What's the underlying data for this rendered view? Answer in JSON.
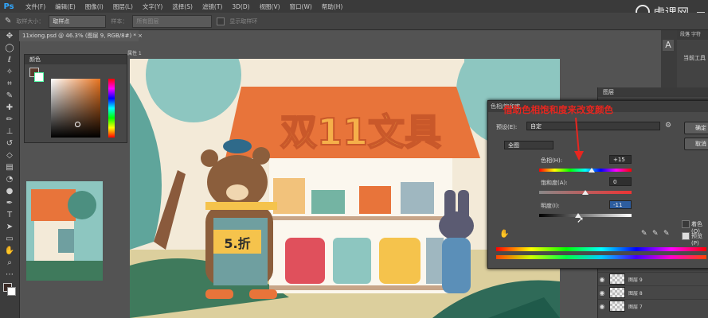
{
  "menu": {
    "logo": "Ps",
    "items": [
      "文件(F)",
      "编辑(E)",
      "图像(I)",
      "图层(L)",
      "文字(Y)",
      "选择(S)",
      "滤镜(T)",
      "3D(D)",
      "视图(V)",
      "窗口(W)",
      "帮助(H)"
    ]
  },
  "watermark": {
    "text": "虎课网"
  },
  "options": {
    "size_label": "取样大小：",
    "size_value": "取样点",
    "sample_label": "样本：",
    "sample_value": "所有图层",
    "ring_label": "显示取样环"
  },
  "document": {
    "tab": "11xiong.psd @ 46.3% (图层 9, RGB/8#) *",
    "tab_close": "×",
    "small_tab": "属性 1"
  },
  "color_panel": {
    "title": "颜色"
  },
  "canvas": {
    "sign": "双11文具",
    "price": "5.折"
  },
  "dialog": {
    "title": "色相/饱和度",
    "preset_label": "预设(E):",
    "preset_value": "自定",
    "channel": "全图",
    "hue_label": "色相(H):",
    "hue_value": "+15",
    "sat_label": "饱和度(A):",
    "sat_value": "0",
    "light_label": "明度(I):",
    "light_value": "-11",
    "ok": "确定",
    "cancel": "取消",
    "colorize": "着色(O)",
    "preview": "预览(P)"
  },
  "annotation": {
    "text": "借助色相饱和度来改变颜色",
    "color": "#e8261f"
  },
  "right": {
    "tab1": "段落",
    "tab2": "字符",
    "current_tool": "当前工具",
    "layers_tab": "图层"
  },
  "layers": [
    {
      "name": "图层 9"
    },
    {
      "name": "图层 8"
    },
    {
      "name": "图层 7"
    }
  ],
  "colors": {
    "accent": "#31a8ff",
    "annotation": "#e8261f",
    "roof": "#e8743a",
    "bg": "#8dc6c0"
  }
}
